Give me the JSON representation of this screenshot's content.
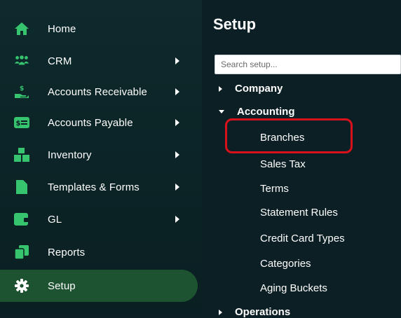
{
  "sidebar": {
    "items": [
      {
        "label": "Home",
        "icon": "home-icon",
        "has_submenu": false
      },
      {
        "label": "CRM",
        "icon": "users-icon",
        "has_submenu": true
      },
      {
        "label": "Accounts Receivable",
        "icon": "hand-dollar-icon",
        "has_submenu": true
      },
      {
        "label": "Accounts Payable",
        "icon": "dollar-card-icon",
        "has_submenu": true
      },
      {
        "label": "Inventory",
        "icon": "boxes-icon",
        "has_submenu": true
      },
      {
        "label": "Templates & Forms",
        "icon": "document-icon",
        "has_submenu": true
      },
      {
        "label": "GL",
        "icon": "wallet-icon",
        "has_submenu": true
      },
      {
        "label": "Reports",
        "icon": "copy-icon",
        "has_submenu": false
      },
      {
        "label": "Setup",
        "icon": "gear-icon",
        "has_submenu": false,
        "active": true
      }
    ]
  },
  "setup": {
    "title": "Setup",
    "search_placeholder": "Search setup...",
    "tree": {
      "company": "Company",
      "accounting": "Accounting",
      "accounting_children": [
        "Branches",
        "Sales Tax",
        "Terms",
        "Statement Rules",
        "Credit Card Types",
        "Categories",
        "Aging Buckets"
      ],
      "operations": "Operations"
    }
  },
  "colors": {
    "background": "#0b1f24",
    "active_item": "#1e5332",
    "icon_green": "#36c46e",
    "highlight_border": "#d8111a"
  }
}
